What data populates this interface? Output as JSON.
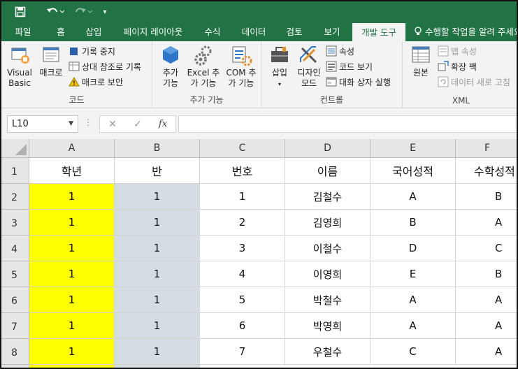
{
  "qat": {
    "save_icon": "save-icon",
    "undo_icon": "undo-icon",
    "redo_icon": "redo-icon",
    "customize_glyph": "▾"
  },
  "tabs": [
    {
      "label": "파일"
    },
    {
      "label": "홈"
    },
    {
      "label": "삽입"
    },
    {
      "label": "페이지 레이아웃"
    },
    {
      "label": "수식"
    },
    {
      "label": "데이터"
    },
    {
      "label": "검토"
    },
    {
      "label": "보기"
    },
    {
      "label": "개발 도구",
      "active": true
    }
  ],
  "tell_me": "수행할 작업을 알려 주세요",
  "ribbon": {
    "code": {
      "label": "코드",
      "visual_basic": "Visual Basic",
      "macros": "매크로",
      "record_macro": "기록 중지",
      "relative_ref": "상대 참조로 기록",
      "macro_security": "매크로 보안"
    },
    "addins": {
      "label": "추가 기능",
      "addins": "추가 기능",
      "excel_addins": "Excel 추가 기능",
      "com_addins": "COM 추가 기능"
    },
    "controls": {
      "label": "컨트롤",
      "insert": "삽입",
      "design_mode": "디자인 모드",
      "properties": "속성",
      "view_code": "코드 보기",
      "run_dialog": "대화 상자 실행"
    },
    "xml": {
      "label": "XML",
      "source": "원본",
      "map_properties": "맵 속성",
      "expansion_packs": "확장 팩",
      "refresh_data": "데이터 새로 고침"
    }
  },
  "formula_bar": {
    "name_box": "L10",
    "cancel_glyph": "✕",
    "enter_glyph": "✓",
    "fx_label": "fx",
    "formula": ""
  },
  "grid": {
    "columns": [
      "A",
      "B",
      "C",
      "D",
      "E",
      "F"
    ],
    "rows": [
      "1",
      "2",
      "3",
      "4",
      "5",
      "6",
      "7",
      "8"
    ],
    "header_row": [
      "학년",
      "반",
      "번호",
      "이름",
      "국어성적",
      "수학성적"
    ],
    "data_rows": [
      [
        "1",
        "1",
        "1",
        "김철수",
        "A",
        "B"
      ],
      [
        "1",
        "1",
        "2",
        "김영희",
        "B",
        "A"
      ],
      [
        "1",
        "1",
        "3",
        "이철수",
        "D",
        "C"
      ],
      [
        "1",
        "1",
        "4",
        "이영희",
        "E",
        "B"
      ],
      [
        "1",
        "1",
        "5",
        "박철수",
        "A",
        "A"
      ],
      [
        "1",
        "1",
        "6",
        "박영희",
        "A",
        "A"
      ],
      [
        "1",
        "1",
        "7",
        "우철수",
        "C",
        "A"
      ]
    ],
    "colors": {
      "col_a_fill": "#ffff00",
      "col_b_fill": "#d6dce4"
    }
  },
  "colors": {
    "excel_green": "#217346"
  }
}
